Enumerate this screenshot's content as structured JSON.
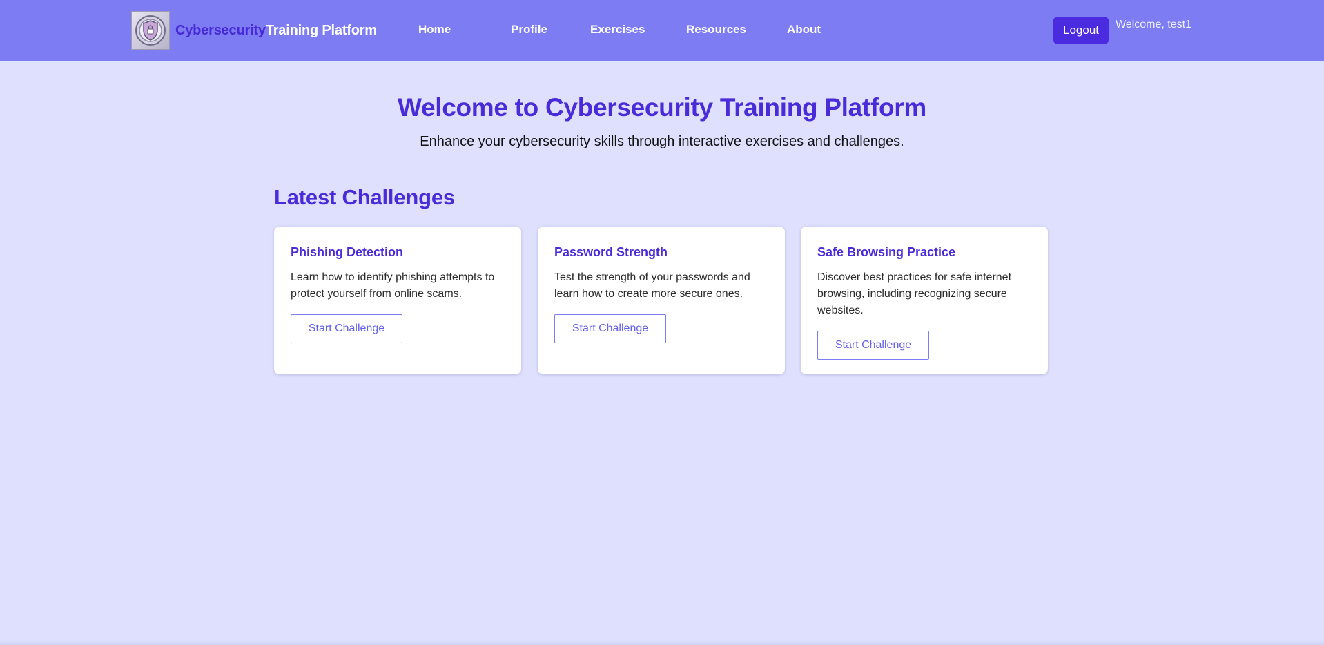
{
  "header": {
    "brand_primary": "Cybersecurity",
    "brand_secondary": "Training Platform",
    "logo_icon": "shield-icon",
    "nav": [
      {
        "label": "Home"
      },
      {
        "label": "Profile"
      },
      {
        "label": "Exercises"
      },
      {
        "label": "Resources"
      },
      {
        "label": "About"
      }
    ],
    "logout_label": "Logout",
    "welcome_text": "Welcome, test1"
  },
  "hero": {
    "title": "Welcome to Cybersecurity Training Platform",
    "subtitle": "Enhance your cybersecurity skills through interactive exercises and challenges."
  },
  "challenges": {
    "section_title": "Latest Challenges",
    "items": [
      {
        "title": "Phishing Detection",
        "description": "Learn how to identify phishing attempts to protect yourself from online scams.",
        "button_label": "Start Challenge"
      },
      {
        "title": "Password Strength",
        "description": "Test the strength of your passwords and learn how to create more secure ones.",
        "button_label": "Start Challenge"
      },
      {
        "title": "Safe Browsing Practice",
        "description": "Discover best practices for safe internet browsing, including recognizing secure websites.",
        "button_label": "Start Challenge"
      }
    ]
  },
  "colors": {
    "navbar": "#7d7cf3",
    "accent": "#4a2bd8",
    "background": "#dee0fd",
    "logout_button": "#4b2be0"
  }
}
